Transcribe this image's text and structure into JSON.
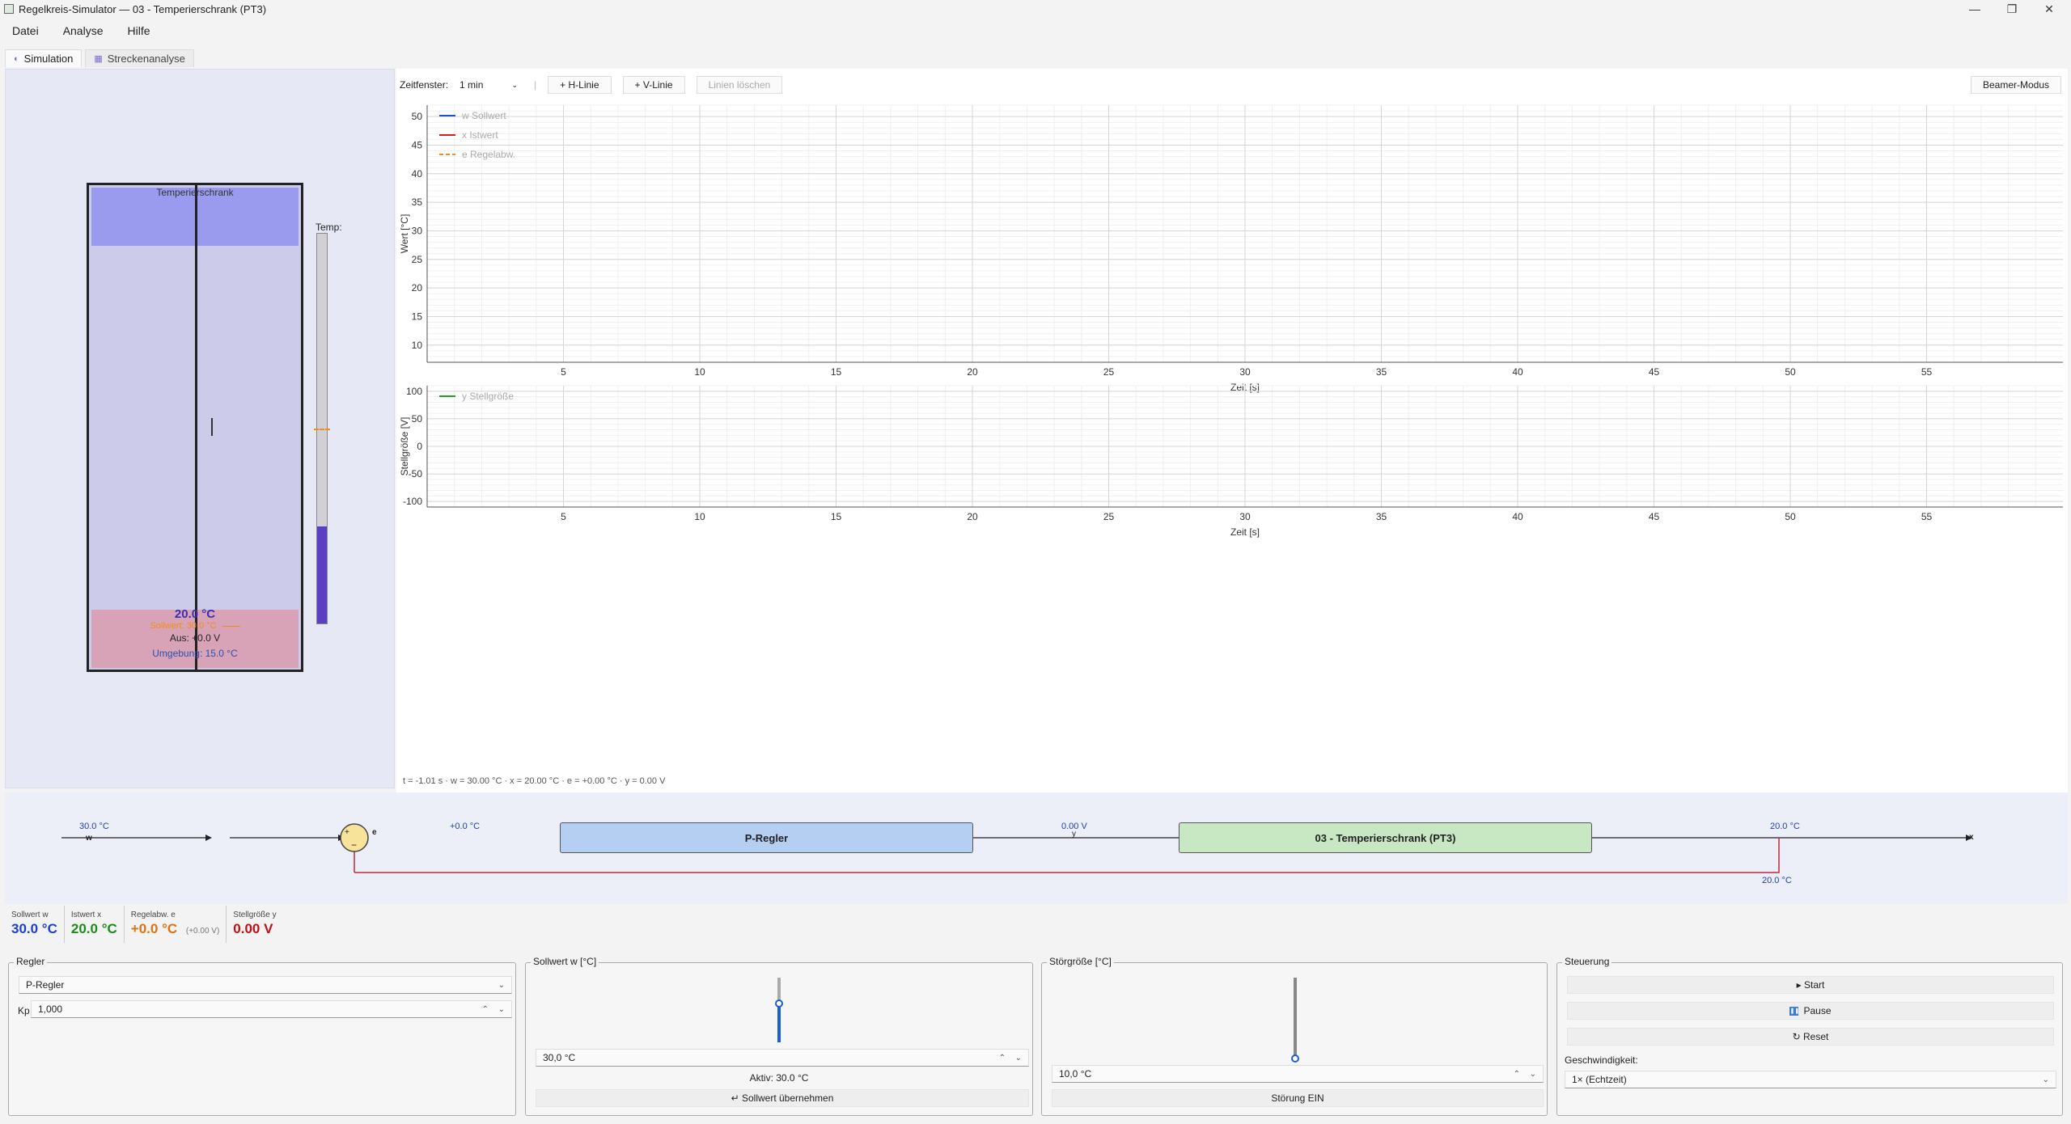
{
  "window": {
    "title": "Regelkreis-Simulator — 03 - Temperierschrank (PT3)",
    "minimize": "—",
    "maximize": "❐",
    "close": "✕"
  },
  "menu": [
    "Datei",
    "Analyse",
    "Hilfe"
  ],
  "tabs": [
    {
      "label": "Simulation",
      "icon": "simulation-icon"
    },
    {
      "label": "Streckenanalyse",
      "icon": "chart-icon"
    }
  ],
  "cabinet": {
    "label": "Temperierschrank",
    "thermo_label": "Temp:",
    "temperature": "20.0 °C",
    "setpoint": "Sollwert: 30.0 °C",
    "output": "Aus: +0.0 V",
    "ambient": "Umgebung: 15.0 °C",
    "fill_fraction": 0.25,
    "setpoint_fraction": 0.5,
    "colors": {
      "heat": "#d9a3b7",
      "cool": "#9a9aee",
      "body": "#ccccea",
      "fill": "#5a3fc4",
      "setpoint": "#f08c1a"
    }
  },
  "toolbar": {
    "window_label": "Zeitfenster:",
    "window_value": "1 min",
    "hline": "+ H-Linie",
    "vline": "+ V-Linie",
    "clear": "Linien löschen",
    "beamer": "Beamer-Modus"
  },
  "chart_data": [
    {
      "type": "line",
      "xlabel": "Zeit [s]",
      "ylabel": "Wert [°C]",
      "xlim": [
        0,
        60
      ],
      "ylim": [
        7,
        52
      ],
      "xticks": [
        5,
        10,
        15,
        20,
        25,
        30,
        35,
        40,
        45,
        50,
        55
      ],
      "yticks": [
        10,
        15,
        20,
        25,
        30,
        35,
        40,
        45,
        50
      ],
      "grid": true,
      "legend_position": "top-left",
      "series": [
        {
          "name": "w Sollwert",
          "color": "#1d4fd0",
          "style": "solid",
          "values": []
        },
        {
          "name": "x Istwert",
          "color": "#d02020",
          "style": "solid",
          "values": []
        },
        {
          "name": "e Regelabw.",
          "color": "#f08c1a",
          "style": "dashed",
          "values": []
        }
      ]
    },
    {
      "type": "line",
      "xlabel": "Zeit [s]",
      "ylabel": "Stellgröße [V]",
      "xlim": [
        0,
        60
      ],
      "ylim": [
        -110,
        110
      ],
      "xticks": [
        5,
        10,
        15,
        20,
        25,
        30,
        35,
        40,
        45,
        50,
        55
      ],
      "yticks": [
        100,
        50,
        0,
        -50,
        -100
      ],
      "grid": true,
      "legend_position": "top-left",
      "series": [
        {
          "name": "y Stellgröße",
          "color": "#22a022",
          "style": "solid",
          "values": []
        }
      ]
    }
  ],
  "status": "t = -1.01 s · w = 30.00 °C · x = 20.00 °C · e = +0.00 °C · y = 0.00 V",
  "diagram": {
    "w_val": "30.0 °C",
    "w": "w",
    "e": "e",
    "e_val": "+0.0 °C",
    "controller": "P-Regler",
    "y_val": "0.00 V",
    "y": "y",
    "plant": "03 - Temperierschrank (PT3)",
    "x_val": "20.0 °C",
    "x": "x",
    "feedback_val": "20.0 °C",
    "plus": "+",
    "minus": "−"
  },
  "values": [
    {
      "label": "Sollwert w",
      "value": "30.0 °C",
      "color": "#1d3fd0"
    },
    {
      "label": "Istwert x",
      "value": "20.0 °C",
      "color": "#1a8a1a"
    },
    {
      "label": "Regelabw. e",
      "value": "+0.0 °C",
      "extra": "(+0.00 V)",
      "color": "#e07010"
    },
    {
      "label": "Stellgröße y",
      "value": "0.00 V",
      "color": "#c01010"
    }
  ],
  "regler": {
    "title": "Regler",
    "type": "P-Regler",
    "kp_label": "Kp",
    "kp_value": "1,000"
  },
  "sollwert": {
    "title": "Sollwert w [°C]",
    "value": "30,0 °C",
    "active": "Aktiv: 30.0 °C",
    "apply": "↵ Sollwert übernehmen",
    "slider_fraction": 0.6
  },
  "stoer": {
    "title": "Störgröße [°C]",
    "value": "10,0 °C",
    "toggle": "Störung EIN",
    "slider_fraction": 0.0
  },
  "steuerung": {
    "title": "Steuerung",
    "start": "▸ Start",
    "pause": "Pause",
    "reset": "↻ Reset",
    "speed_label": "Geschwindigkeit:",
    "speed_value": "1× (Echtzeit)"
  }
}
